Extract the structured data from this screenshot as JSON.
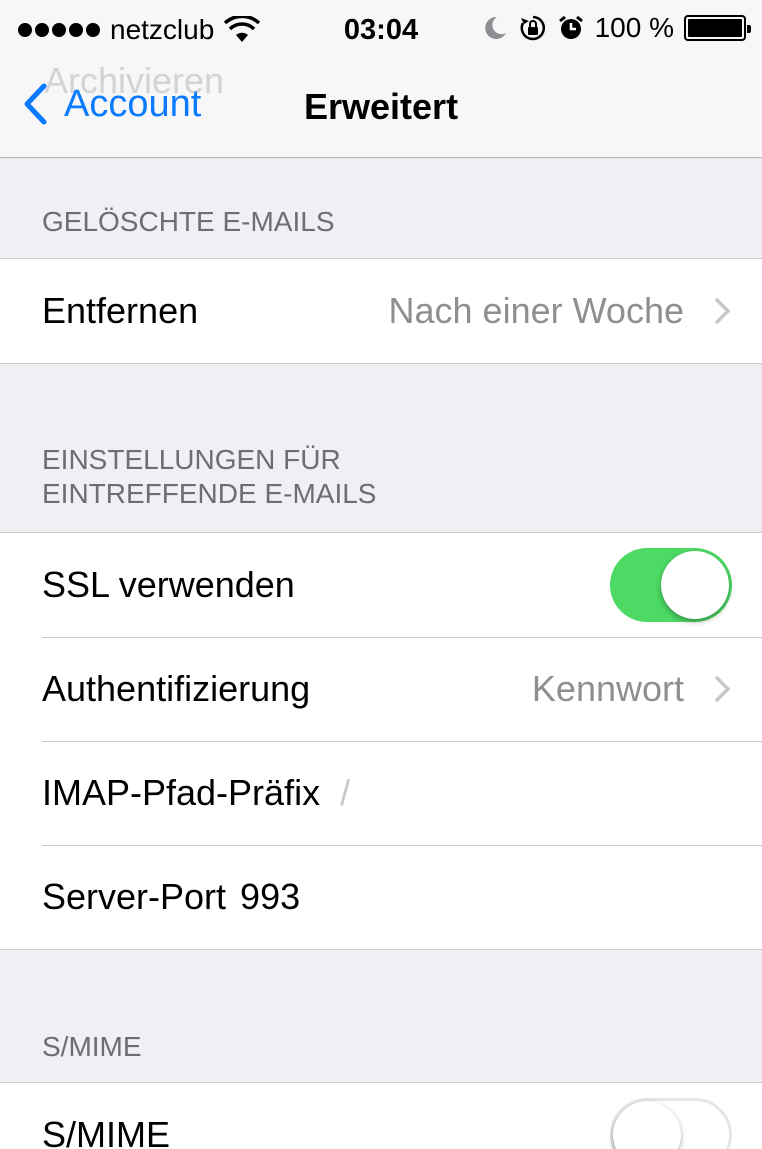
{
  "status_bar": {
    "carrier": "netzclub",
    "time": "03:04",
    "battery_percent": "100 %",
    "icons": [
      "signal-dots-icon",
      "wifi-icon",
      "moon-icon",
      "rotation-lock-icon",
      "alarm-icon",
      "battery-icon"
    ]
  },
  "nav": {
    "ghost_title": "Archivieren",
    "back_label": "Account",
    "title": "Erweitert"
  },
  "sections": {
    "deleted": {
      "header": "GELÖSCHTE E-MAILS",
      "remove_label": "Entfernen",
      "remove_value": "Nach einer Woche"
    },
    "incoming": {
      "header_line1": "EINSTELLUNGEN FÜR",
      "header_line2": "EINTREFFENDE E-MAILS",
      "ssl_label": "SSL verwenden",
      "ssl_on": true,
      "auth_label": "Authentifizierung",
      "auth_value": "Kennwort",
      "imap_label": "IMAP-Pfad-Präfix",
      "imap_value": "/",
      "port_label": "Server-Port",
      "port_value": "993"
    },
    "smime": {
      "header": "S/MIME",
      "smime_label": "S/MIME",
      "smime_on": false
    }
  },
  "colors": {
    "accent": "#0a7aff",
    "toggle_on": "#4cd964",
    "background": "#efeff4"
  }
}
